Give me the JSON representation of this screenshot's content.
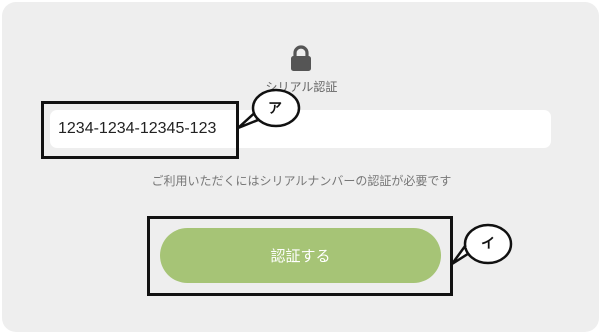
{
  "form": {
    "lock_icon": "lock-icon",
    "serial_label": "シリアル認証",
    "serial_value": "1234-1234-12345-123",
    "help_text": "ご利用いただくにはシリアルナンバーの認証が必要です",
    "submit_label": "認証する"
  },
  "annotations": {
    "callout_a": "ア",
    "callout_b": "イ"
  },
  "colors": {
    "panel_bg": "#eeeeee",
    "button_green": "#a6c476",
    "annotation_black": "#111111"
  }
}
